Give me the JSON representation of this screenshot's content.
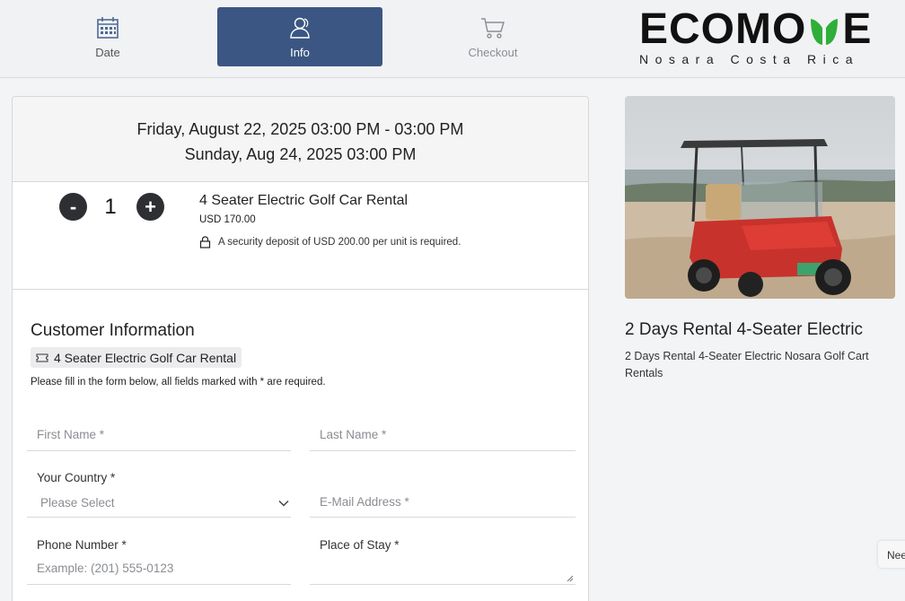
{
  "steps": [
    {
      "label": "Date",
      "icon": "calendar-icon"
    },
    {
      "label": "Info",
      "icon": "user-icon",
      "active": true
    },
    {
      "label": "Checkout",
      "icon": "cart-icon"
    }
  ],
  "brand": {
    "name": "ECOMOVE",
    "name_left": "ECOMO",
    "name_right": "E",
    "subtitle": "Nosara Costa Rica",
    "leaf_color": "#2fae3a"
  },
  "booking": {
    "start": "Friday, August 22, 2025 03:00 PM - 03:00 PM",
    "end": "Sunday, Aug 24, 2025 03:00 PM"
  },
  "product": {
    "quantity": "1",
    "minus_label": "-",
    "plus_label": "+",
    "title": "4 Seater Electric Golf Car Rental",
    "price": "USD 170.00",
    "deposit": "A security deposit of USD 200.00 per unit is required."
  },
  "form": {
    "title": "Customer Information",
    "tag": "4 Seater Electric Golf Car Rental",
    "instructions": "Please fill in the form below, all fields marked with * are required.",
    "first_name_placeholder": "First Name *",
    "last_name_placeholder": "Last Name *",
    "country_label": "Your Country *",
    "country_value": "Please Select",
    "email_placeholder": "E-Mail Address *",
    "phone_label": "Phone Number *",
    "phone_placeholder": "Example: (201) 555-0123",
    "stay_label": "Place of Stay *"
  },
  "sidebar": {
    "image_alt": "red golf cart on beach",
    "title": "2 Days Rental 4-Seater Electric",
    "description": "2 Days Rental 4-Seater Electric Nosara Golf Cart Rentals"
  },
  "help_tab": "Nee",
  "colors": {
    "active_step": "#3b5682",
    "qty_button": "#2d2f33"
  }
}
